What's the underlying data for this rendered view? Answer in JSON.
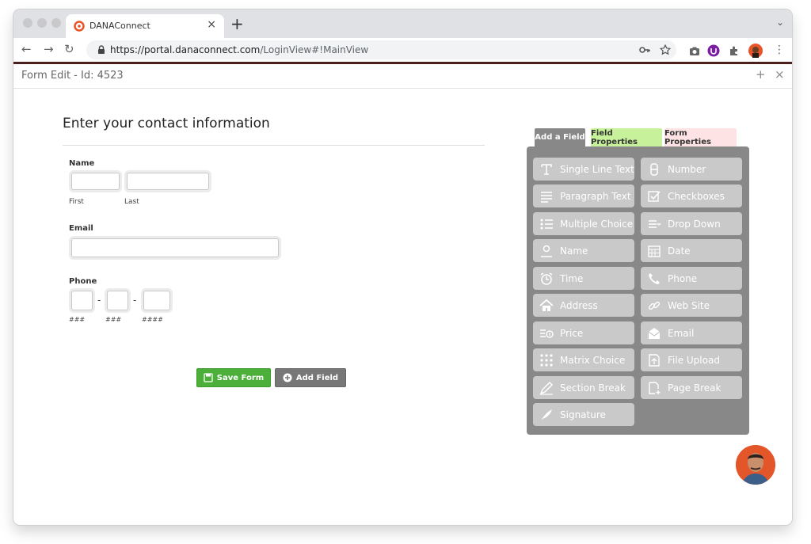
{
  "browser": {
    "tab_title": "DANAConnect",
    "tab_close": "×",
    "new_tab": "+",
    "tab_menu": "⌄",
    "nav_back": "←",
    "nav_forward": "→",
    "nav_reload": "↻",
    "url_scheme": "https://",
    "url_host": "portal.danaconnect.com",
    "url_path": "/LoginView#!MainView",
    "menu_dots": "⋮"
  },
  "app": {
    "title": "Form Edit - Id: 4523",
    "plus": "+",
    "close": "×"
  },
  "form": {
    "heading": "Enter your contact information",
    "name_label": "Name",
    "first_label": "First",
    "last_label": "Last",
    "email_label": "Email",
    "phone_label": "Phone",
    "phone_dash": "-",
    "phone_hint_1": "###",
    "phone_hint_2": "###",
    "phone_hint_3": "####",
    "save_label": "Save Form",
    "add_field_label": "Add Field"
  },
  "panel": {
    "tabs": [
      {
        "label": "Add a Field",
        "color": "#888888"
      },
      {
        "label": "Field Properties",
        "color": "#c7f19a"
      },
      {
        "label": "Form Properties",
        "color": "#fde3e3"
      }
    ],
    "fields": [
      {
        "label": "Single Line Text",
        "icon": "text-icon"
      },
      {
        "label": "Number",
        "icon": "number-icon"
      },
      {
        "label": "Paragraph Text",
        "icon": "paragraph-icon"
      },
      {
        "label": "Checkboxes",
        "icon": "checkbox-icon"
      },
      {
        "label": "Multiple Choice",
        "icon": "list-icon"
      },
      {
        "label": "Drop Down",
        "icon": "dropdown-icon"
      },
      {
        "label": "Name",
        "icon": "person-icon"
      },
      {
        "label": "Date",
        "icon": "calendar-icon"
      },
      {
        "label": "Time",
        "icon": "alarm-clock-icon"
      },
      {
        "label": "Phone",
        "icon": "phone-icon"
      },
      {
        "label": "Address",
        "icon": "home-icon"
      },
      {
        "label": "Web Site",
        "icon": "link-icon"
      },
      {
        "label": "Price",
        "icon": "price-icon"
      },
      {
        "label": "Email",
        "icon": "envelope-icon"
      },
      {
        "label": "Matrix Choice",
        "icon": "grid-icon"
      },
      {
        "label": "File Upload",
        "icon": "upload-icon"
      },
      {
        "label": "Section Break",
        "icon": "pencil-icon"
      },
      {
        "label": "Page Break",
        "icon": "page-break-icon"
      },
      {
        "label": "Signature",
        "icon": "feather-icon"
      }
    ]
  },
  "colors": {
    "save_button": "#4caf3a",
    "add_button": "#777777",
    "panel_bg": "#888888",
    "field_button": "#c9c9c9",
    "toolbar_accent": "#4a1f1c"
  }
}
